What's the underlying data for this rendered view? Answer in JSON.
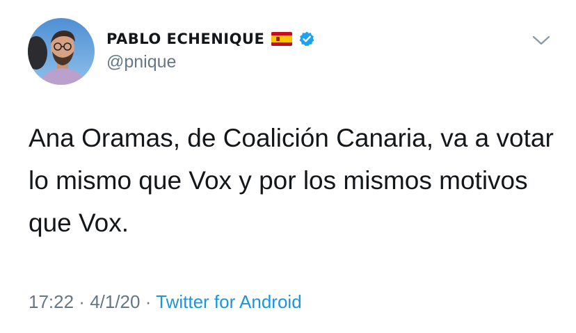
{
  "author": {
    "display_name": "PABLO ECHENIQUE",
    "handle": "@pnique",
    "flag_icon": "spain-flag-icon",
    "verified_icon": "verified-badge-icon"
  },
  "menu": {
    "icon": "chevron-down-icon"
  },
  "tweet": {
    "text": "Ana Oramas, de Coalición Canaria, va a votar lo mismo que Vox y por los mismos motivos que Vox."
  },
  "meta": {
    "time": "17:22",
    "separator_1": " · ",
    "date": "4/1/20",
    "separator_2": " · ",
    "source": "Twitter for Android"
  },
  "colors": {
    "text": "#14171a",
    "muted": "#657786",
    "link": "#1b95e0",
    "verified": "#1da1f2"
  }
}
